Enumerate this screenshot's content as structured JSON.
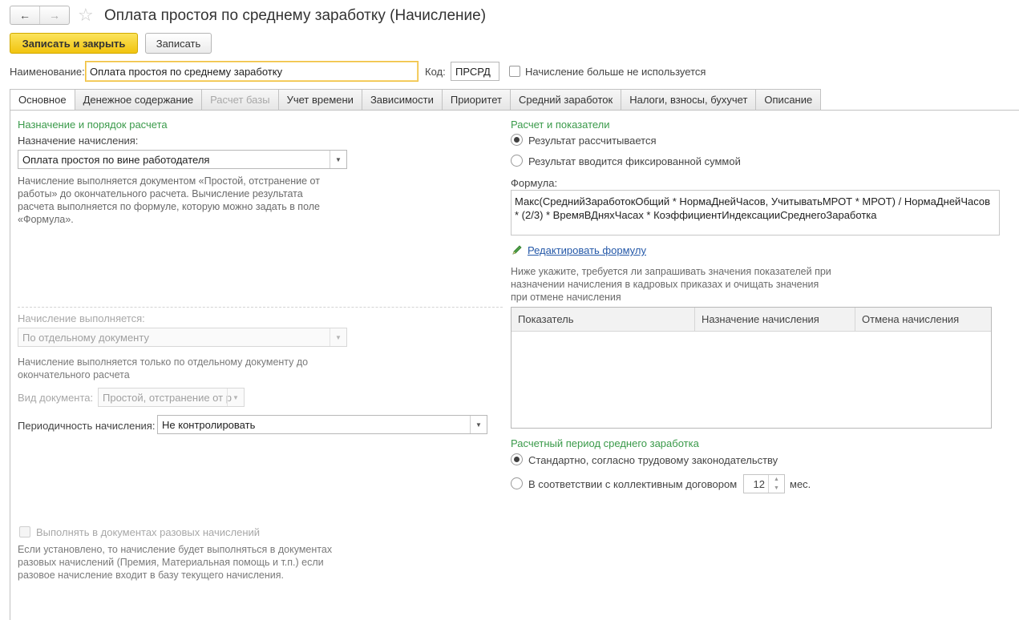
{
  "window": {
    "title": "Оплата простоя по среднему заработку (Начисление)",
    "back_icon": "←",
    "forward_icon": "→",
    "star_icon": "☆"
  },
  "toolbar": {
    "save_close_label": "Записать и закрыть",
    "save_label": "Записать"
  },
  "header": {
    "name_label": "Наименование:",
    "name_value": "Оплата простоя по среднему заработку",
    "code_label": "Код:",
    "code_value": "ПРСРД",
    "not_used_label": "Начисление больше не используется"
  },
  "tabs": [
    {
      "label": "Основное"
    },
    {
      "label": "Денежное содержание"
    },
    {
      "label": "Расчет базы"
    },
    {
      "label": "Учет времени"
    },
    {
      "label": "Зависимости"
    },
    {
      "label": "Приоритет"
    },
    {
      "label": "Средний заработок"
    },
    {
      "label": "Налоги, взносы, бухучет"
    },
    {
      "label": "Описание"
    }
  ],
  "left": {
    "section_title": "Назначение и порядок расчета",
    "purpose_label": "Назначение начисления:",
    "purpose_value": "Оплата простоя по вине работодателя",
    "purpose_note": "Начисление выполняется документом «Простой, отстранение от работы» до окончательного расчета. Вычисление результата расчета выполняется по формуле, которую можно задать в поле «Формула».",
    "performed_label": "Начисление выполняется:",
    "performed_value": "По отдельному документу",
    "performed_note": "Начисление выполняется только по отдельному документу до окончательного расчета",
    "doc_type_label": "Вид документа:",
    "doc_type_value": "Простой, отстранение от р",
    "period_label": "Периодичность начисления:",
    "period_value": "Не контролировать",
    "oneoff_label": "Выполнять в документах разовых начислений",
    "oneoff_note": "Если установлено, то начисление будет выполняться в документах разовых начислений (Премия, Материальная помощь и т.п.) если разовое начисление входит в базу текущего начисления."
  },
  "right": {
    "section_title": "Расчет и показатели",
    "radio_calc": "Результат рассчитывается",
    "radio_fixed": "Результат вводится фиксированной суммой",
    "formula_label": "Формула:",
    "formula_value": "Макс(СреднийЗаработокОбщий * НормаДнейЧасов, УчитыватьМРОТ * МРОТ) / НормаДнейЧасов * (2/3) * ВремяВДняхЧасах * КоэффициентИндексацииСреднегоЗаработка",
    "edit_formula_link": "Редактировать формулу",
    "indicators_note": "Ниже укажите, требуется ли запрашивать значения показателей при назначении начисления в кадровых приказах и очищать значения при отмене начисления",
    "table_headers": [
      "Показатель",
      "Назначение начисления",
      "Отмена начисления"
    ],
    "period_section_title": "Расчетный период среднего заработка",
    "radio_standard": "Стандартно, согласно трудовому законодательству",
    "radio_collective": "В соответствии с коллективным договором",
    "months_value": "12",
    "months_unit": "мес."
  },
  "colors": {
    "primary_button": "#f1c40f",
    "section_title": "#3a9a4a",
    "link": "#2458a8"
  }
}
